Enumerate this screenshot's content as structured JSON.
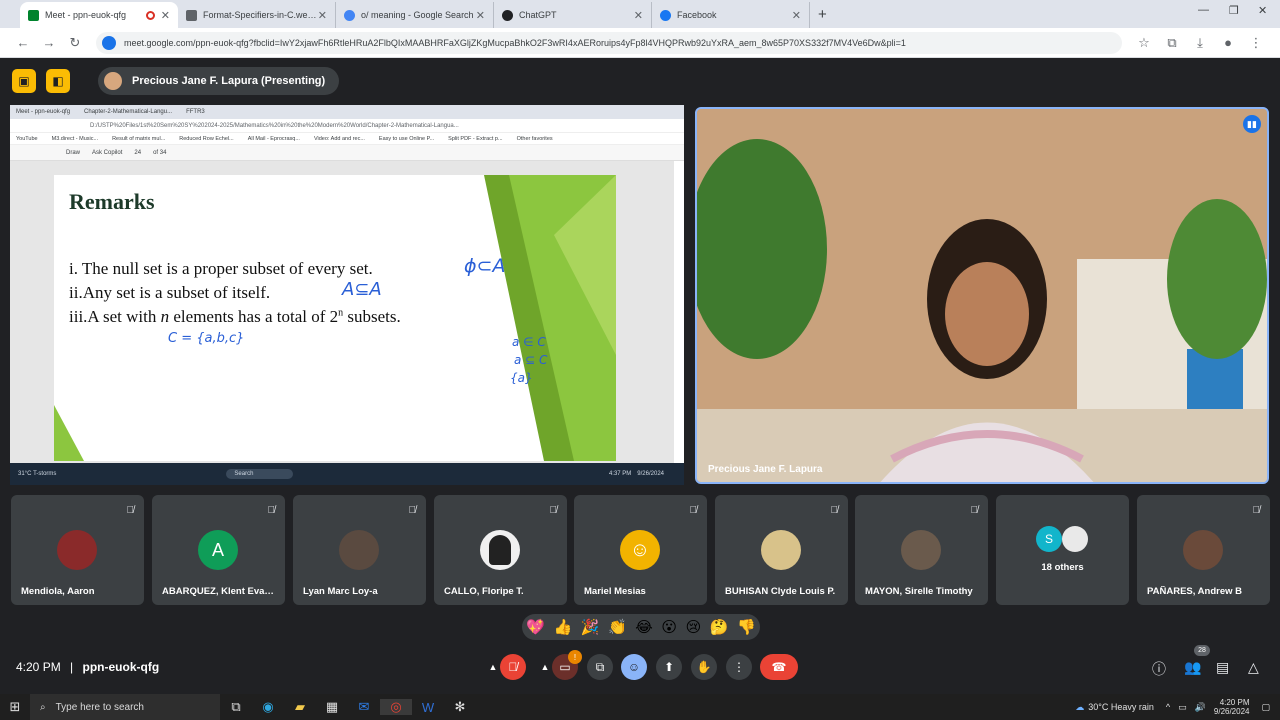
{
  "browser": {
    "tabs": [
      {
        "label": "Meet - ppn-euok-qfg",
        "color": "#00832d",
        "active": true
      },
      {
        "label": "Format-Specifiers-in-C.webp (8",
        "color": "#5f6368",
        "active": false
      },
      {
        "label": "o/ meaning - Google Search",
        "color": "#4285f4",
        "active": false
      },
      {
        "label": "ChatGPT",
        "color": "#202124",
        "active": false
      },
      {
        "label": "Facebook",
        "color": "#1877f2",
        "active": false
      }
    ],
    "new_tab": "+",
    "url": "meet.google.com/ppn-euok-qfg?fbclid=IwY2xjawFh6RtleHRuA2FlbQIxMAABHRFaXGljZKgMucpaBhkO2F3wRI4xAERoruips4yFp8l4VHQPRwb92uYxRA_aem_8w65P70XS332f7MV4Ve6Dw&pli=1"
  },
  "meet": {
    "presenter_chip": "Precious Jane F. Lapura (Presenting)",
    "speaker_name": "Precious Jane F. Lapura",
    "time": "4:20 PM",
    "separator": "|",
    "meeting_code": "ppn-euok-qfg",
    "people_count": "28",
    "leave_icon": "phone-hangup-icon"
  },
  "shared_screen": {
    "tabs": [
      "Meet - ppn-euok-qfg",
      "Chapter-2-Mathematical-Langu...",
      "FFTR3"
    ],
    "address": "D:/USTP%20Files/1st%20Sem%20SY%202024-2025/Mathematics%20in%20the%20Modern%20World/Chapter-2-Mathematical-Langua...",
    "bookmarks": [
      "YouTube",
      "M3.direct - Music...",
      "Result of matrix mul...",
      "Reduced Row Echel...",
      "All Mail - Eprocrasq...",
      "Video: Add and rec...",
      "Easy to use Online P...",
      "Split PDF - Extract p...",
      "Other favorites"
    ],
    "toolbar": [
      "Draw",
      "Ask Copilot",
      "24",
      "of 34"
    ],
    "slide": {
      "title": "Remarks",
      "item1": "i. The null set is a proper subset of every set.",
      "item2": "ii.Any set is a subset of itself.",
      "item3_a": "iii.A set with ",
      "item3_n": "n",
      "item3_b": " elements has a total of 2",
      "item3_sup": "n",
      "item3_c": " subsets.",
      "hw1": "ϕ⊂A",
      "hw2": "A⊆A",
      "hw3": "C = {a,b,c}",
      "hw4": "a ∈ C",
      "hw5": "a ⊆ C",
      "hw6": "{a}"
    },
    "taskbar": {
      "search": "Search",
      "weather_temp": "31°C",
      "weather_text": "T-storms",
      "time": "4:37 PM",
      "date": "9/26/2024"
    }
  },
  "participants": [
    {
      "name": "Mendiola, Aaron",
      "avatar": "photo",
      "color": "#8a2a2a"
    },
    {
      "name": "ABARQUEZ, Klent Evan...",
      "avatar": "A",
      "color": "#0f9d58"
    },
    {
      "name": "Lyan Marc Loy-a",
      "avatar": "photo",
      "color": "#5a4a40"
    },
    {
      "name": "CALLO, Floripe T.",
      "avatar": "photo",
      "color": "#222222"
    },
    {
      "name": "Mariel Mesias",
      "avatar": "photo",
      "color": "#f2b300"
    },
    {
      "name": "BUHISAN Clyde Louis P.",
      "avatar": "photo",
      "color": "#d8c28a"
    },
    {
      "name": "MAYON, Sirelle Timothy",
      "avatar": "photo",
      "color": "#6a5a4c"
    },
    {
      "name": "18 others",
      "avatar": "S",
      "color": "#12b5cb"
    },
    {
      "name": "PAÑARES, Andrew B",
      "avatar": "photo",
      "color": "#6a4a3a"
    }
  ],
  "reactions": [
    "💖",
    "👍",
    "🎉",
    "👏",
    "😂",
    "😮",
    "😢",
    "🤔",
    "👎"
  ],
  "windows": {
    "search_placeholder": "Type here to search",
    "weather": "30°C  Heavy rain",
    "time": "4:20 PM",
    "date": "9/26/2024"
  }
}
